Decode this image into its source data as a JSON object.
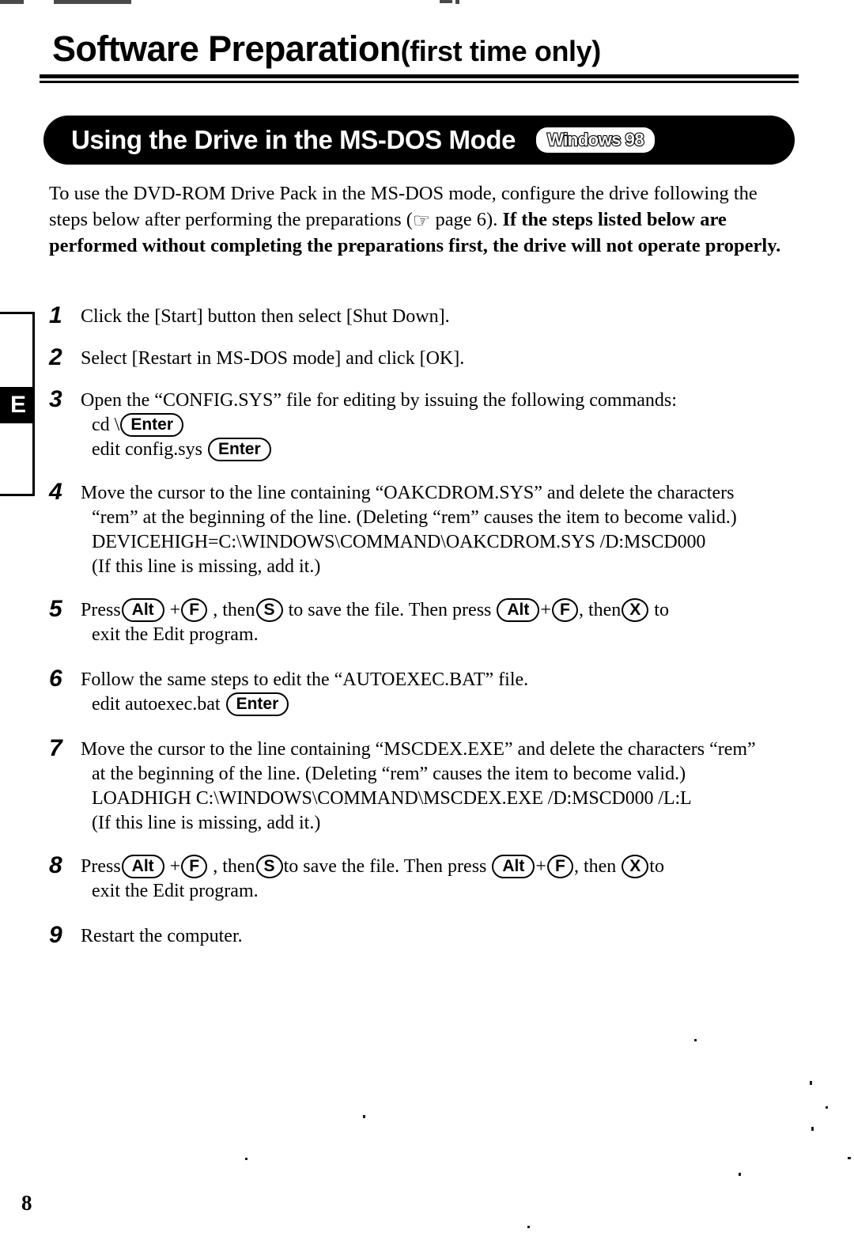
{
  "document": {
    "title_main": "Software Preparation",
    "title_sub": "(first time only)",
    "page_number": "8"
  },
  "section": {
    "heading": "Using the Drive in the MS-DOS Mode",
    "os_badge": "Windows 98"
  },
  "intro": {
    "part1": "To use the DVD-ROM Drive Pack in the MS-DOS mode, configure the drive following the steps below after performing the preparations (",
    "hand_icon": "☞",
    "part2": " page 6).  ",
    "bold_part": "If the steps listed below are performed without completing the preparations first, the drive will not operate properly."
  },
  "margin_tabs": {
    "active_label": "E"
  },
  "steps": [
    {
      "number": "1",
      "lines": [
        "Click the [Start] button then select [Shut Down]."
      ]
    },
    {
      "number": "2",
      "lines": [
        "Select [Restart in MS-DOS mode] and click [OK]."
      ]
    },
    {
      "number": "3",
      "lines": [
        "Open the “CONFIG.SYS” file for editing by issuing the following commands:",
        "cd \\",
        "edit config.sys"
      ],
      "key_line2": "Enter",
      "key_line3": "Enter"
    },
    {
      "number": "4",
      "lines": [
        "Move the cursor to the line containing “OAKCDROM.SYS” and delete the characters",
        "“rem” at the beginning of the line. (Deleting “rem” causes the item to become valid.)",
        "DEVICEHIGH=C:\\WINDOWS\\COMMAND\\OAKCDROM.SYS /D:MSCD000",
        "(If this line is missing, add it.)"
      ]
    },
    {
      "number": "5",
      "press_label": "Press",
      "key_alt_1": "Alt",
      "plus_1": "+",
      "key_f_1": "F",
      "then_1": ", then",
      "key_s": "S",
      "save_text": "to save the file.  Then press",
      "key_alt_2": "Alt",
      "plus_2": "+",
      "key_f_2": "F",
      "then_2": ", then",
      "key_x": "X",
      "tail": "to",
      "line2": "exit the Edit program."
    },
    {
      "number": "6",
      "lines": [
        "Follow the same steps to edit the “AUTOEXEC.BAT” file.",
        "edit autoexec.bat"
      ],
      "key_line2": "Enter"
    },
    {
      "number": "7",
      "lines": [
        "Move the cursor to the line containing “MSCDEX.EXE” and delete the characters “rem”",
        "at the beginning of the line. (Deleting “rem” causes the item to become valid.)",
        "LOADHIGH  C:\\WINDOWS\\COMMAND\\MSCDEX.EXE /D:MSCD000 /L:L",
        "(If this line is missing, add it.)"
      ]
    },
    {
      "number": "8",
      "press_label": "Press",
      "key_alt_1": "Alt",
      "plus_1": "+",
      "key_f_1": "F",
      "then_1": ", then",
      "key_s": "S",
      "save_text": "to save the file.  Then press",
      "key_alt_2": "Alt",
      "plus_2": "+",
      "key_f_2": "F",
      "then_2": ", then",
      "key_x": "X",
      "tail": "to",
      "line2": "exit the Edit program."
    },
    {
      "number": "9",
      "lines": [
        "Restart the computer."
      ]
    }
  ],
  "colors": {
    "ink": "#000000",
    "paper": "#ffffff"
  }
}
